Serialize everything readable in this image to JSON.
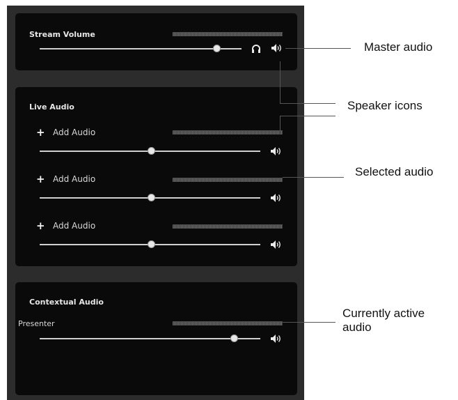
{
  "stream_volume": {
    "title": "Stream Volume",
    "slider_level": 0.8
  },
  "live_audio": {
    "title": "Live Audio",
    "rows": [
      {
        "label": "Add Audio",
        "slider_level": 0.5
      },
      {
        "label": "Add Audio",
        "slider_level": 0.5
      },
      {
        "label": "Add Audio",
        "slider_level": 0.5
      }
    ]
  },
  "contextual_audio": {
    "title": "Contextual Audio",
    "source": "Presenter",
    "slider_level": 0.88
  },
  "icons": {
    "add": "plus-icon",
    "speaker": "speaker-icon",
    "headphones": "headphones-icon"
  },
  "callouts": {
    "master": "Master audio",
    "speakers": "Speaker icons",
    "selected": "Selected audio",
    "active": "Currently active audio"
  },
  "colors": {
    "panel": "#2c2c2c",
    "section": "#0a0a0a",
    "text": "#e6e6e6"
  }
}
